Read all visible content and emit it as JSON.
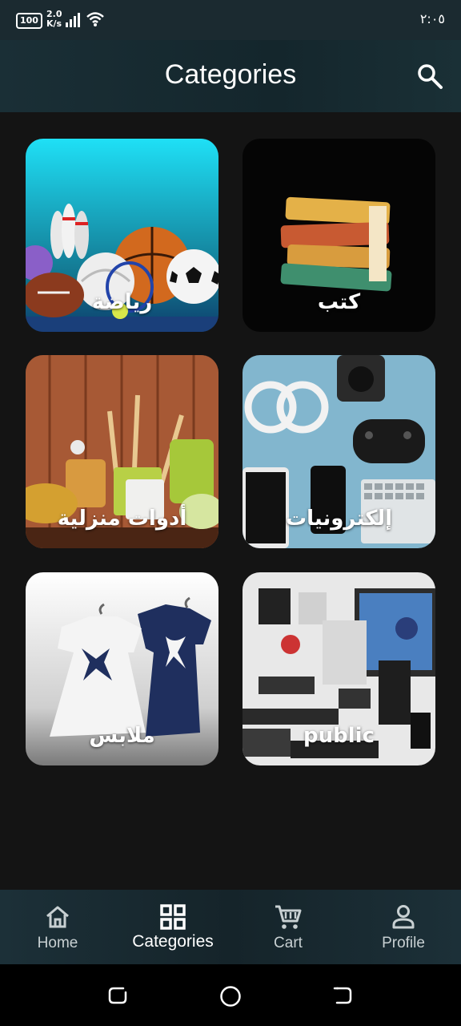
{
  "status_bar": {
    "battery": "100",
    "net_speed_value": "2.0",
    "net_speed_unit": "K/s",
    "time": "٢:٠٥"
  },
  "app_bar": {
    "title": "Categories",
    "search_icon": "search-icon"
  },
  "categories": [
    {
      "label": "رياضة",
      "image": "sports-balls"
    },
    {
      "label": "كتب",
      "image": "books-stack"
    },
    {
      "label": "أدوات منزلية",
      "image": "kitchen-utensils"
    },
    {
      "label": "إلكترونيات",
      "image": "electronics-desk"
    },
    {
      "label": "ملابس",
      "image": "kids-dresses"
    },
    {
      "label": "public",
      "image": "electronics-collage"
    }
  ],
  "bottom_nav": {
    "items": [
      {
        "label": "Home",
        "icon": "home-icon"
      },
      {
        "label": "Categories",
        "icon": "grid-icon",
        "active": true
      },
      {
        "label": "Cart",
        "icon": "cart-icon"
      },
      {
        "label": "Profile",
        "icon": "person-icon"
      }
    ]
  },
  "colors": {
    "background": "#141414",
    "app_bar": "#1a2f36",
    "nav_inactive": "#c8d0d2"
  }
}
